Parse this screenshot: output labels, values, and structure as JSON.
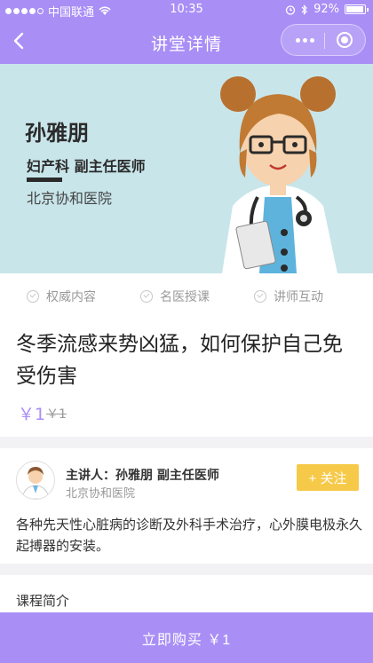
{
  "status_bar": {
    "carrier": "中国联通",
    "time": "10:35",
    "battery": "92%"
  },
  "nav": {
    "title": "讲堂详情"
  },
  "banner": {
    "doctor_name": "孙雅朋",
    "doctor_title": "妇产科  副主任医师",
    "hospital": "北京协和医院"
  },
  "badges": [
    {
      "label": "权威内容",
      "icon": "check-circle-icon"
    },
    {
      "label": "名医授课",
      "icon": "check-circle-icon"
    },
    {
      "label": "讲师互动",
      "icon": "check-circle-icon"
    }
  ],
  "course": {
    "title": "冬季流感来势凶猛，如何保护自己免受伤害",
    "price": "￥1",
    "original_price": "￥1"
  },
  "lecturer": {
    "name_line": "主讲人：孙雅朋  副主任医师",
    "hospital": "北京协和医院",
    "follow_label": "+ 关注",
    "description": "各种先天性心脏病的诊断及外科手术治疗，心外膜电极永久起搏器的安装。"
  },
  "intro": {
    "label": "课程简介"
  },
  "buy": {
    "label": "立即购买  ￥1"
  },
  "colors": {
    "accent": "#a98ef6",
    "banner_bg": "#c8e5ea",
    "follow": "#f7c948"
  }
}
